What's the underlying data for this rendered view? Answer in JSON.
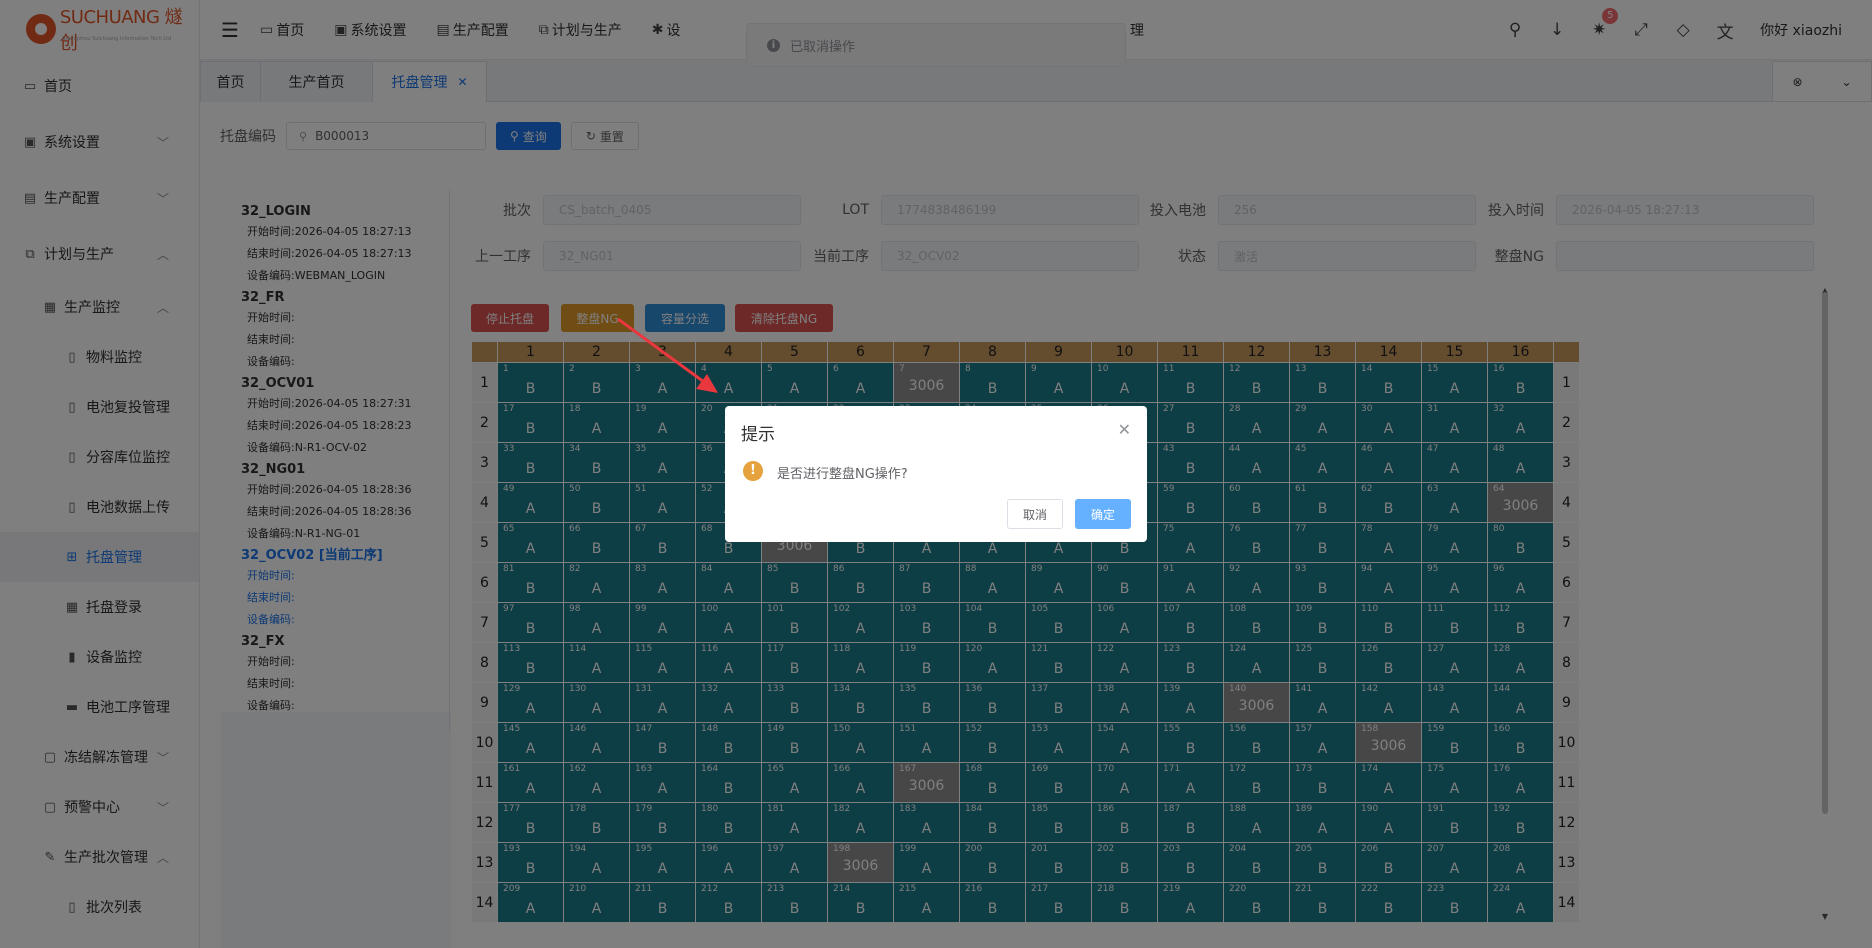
{
  "brand": {
    "logo_text": "SUCHUANG 燧创",
    "logo_sub": "Guangzhou Suichuang Information Tech Ltd"
  },
  "sidebar": {
    "items": [
      {
        "label": "首页",
        "icon": "monitor-icon",
        "level": 1
      },
      {
        "label": "系统设置",
        "icon": "user-badge-icon",
        "level": 1,
        "arrow": "down"
      },
      {
        "label": "生产配置",
        "icon": "briefcase-icon",
        "level": 1,
        "arrow": "down"
      },
      {
        "label": "计划与生产",
        "icon": "link-icon",
        "level": 1,
        "arrow": "up"
      },
      {
        "label": "生产监控",
        "icon": "device-icon",
        "level": 2,
        "arrow": "up"
      },
      {
        "label": "物料监控",
        "icon": "document-icon",
        "level": 3
      },
      {
        "label": "电池复投管理",
        "icon": "document-icon",
        "level": 3
      },
      {
        "label": "分容库位监控",
        "icon": "document-icon",
        "level": 3
      },
      {
        "label": "电池数据上传",
        "icon": "document-icon",
        "level": 3
      },
      {
        "label": "托盘管理",
        "icon": "basket-icon",
        "level": 3,
        "active": true
      },
      {
        "label": "托盘登录",
        "icon": "table-icon",
        "level": 3
      },
      {
        "label": "设备监控",
        "icon": "server-icon",
        "level": 3
      },
      {
        "label": "电池工序管理",
        "icon": "battery-icon",
        "level": 3
      },
      {
        "label": "冻结解冻管理",
        "icon": "folder-icon",
        "level": 2,
        "arrow": "down"
      },
      {
        "label": "预警中心",
        "icon": "folder-icon",
        "level": 2,
        "arrow": "down"
      },
      {
        "label": "生产批次管理",
        "icon": "edit-icon",
        "level": 2,
        "arrow": "up"
      },
      {
        "label": "批次列表",
        "icon": "document-icon",
        "level": 3
      }
    ]
  },
  "topnav": {
    "items": [
      {
        "label": "首页",
        "icon": "monitor-icon"
      },
      {
        "label": "系统设置",
        "icon": "user-badge-icon"
      },
      {
        "label": "生产配置",
        "icon": "briefcase-icon"
      },
      {
        "label": "计划与生产",
        "icon": "link-icon"
      },
      {
        "label": "设",
        "icon": "gear-icon"
      }
    ],
    "hidden_tail": "理",
    "greeting": "你好 xiaozhi",
    "notify_count": "5"
  },
  "toast": {
    "text": "已取消操作"
  },
  "tabs": {
    "items": [
      {
        "label": "首页"
      },
      {
        "label": "生产首页"
      },
      {
        "label": "托盘管理",
        "active": true
      }
    ]
  },
  "search": {
    "label": "托盘编码",
    "value": "B000013",
    "query": "查询",
    "reset": "重置"
  },
  "process": [
    {
      "name": "32_LOGIN",
      "lines": [
        "开始时间:2026-04-05 18:27:13",
        "结束时间:2026-04-05 18:27:13",
        "设备编码:WEBMAN_LOGIN"
      ]
    },
    {
      "name": "32_FR",
      "lines": [
        "开始时间:",
        "结束时间:",
        "设备编码:"
      ]
    },
    {
      "name": "32_OCV01",
      "lines": [
        "开始时间:2026-04-05 18:27:31",
        "结束时间:2026-04-05 18:28:23",
        "设备编码:N-R1-OCV-02"
      ]
    },
    {
      "name": "32_NG01",
      "lines": [
        "开始时间:2026-04-05 18:28:36",
        "结束时间:2026-04-05 18:28:36",
        "设备编码:N-R1-NG-01"
      ]
    },
    {
      "name": "32_OCV02 [当前工序]",
      "lines": [
        "开始时间:",
        "结束时间:",
        "设备编码:"
      ],
      "current": true
    },
    {
      "name": "32_FX",
      "lines": [
        "开始时间:",
        "结束时间:",
        "设备编码:"
      ]
    }
  ],
  "form": {
    "fields": [
      {
        "label": "批次",
        "value": "CS_batch_0405"
      },
      {
        "label": "LOT",
        "value": "1774838486199"
      },
      {
        "label": "投入电池",
        "value": "256"
      },
      {
        "label": "投入时间",
        "value": "2026-04-05 18:27:13"
      },
      {
        "label": "上一工序",
        "value": "32_NG01"
      },
      {
        "label": "当前工序",
        "value": "32_OCV02"
      },
      {
        "label": "状态",
        "value": "激活"
      },
      {
        "label": "整盘NG",
        "value": ""
      }
    ]
  },
  "actions": [
    {
      "label": "停止托盘",
      "color": "#d9534f"
    },
    {
      "label": "整盘NG",
      "color": "#e09a2b"
    },
    {
      "label": "容量分选",
      "color": "#2e8ed6"
    },
    {
      "label": "清除托盘NG",
      "color": "#d9534f"
    }
  ],
  "tray": {
    "columns": [
      "1",
      "2",
      "3",
      "4",
      "5",
      "6",
      "7",
      "8",
      "9",
      "10",
      "11",
      "12",
      "13",
      "14",
      "15",
      "16"
    ],
    "row_labels": [
      "1",
      "2",
      "3",
      "4",
      "5",
      "6",
      "7",
      "8",
      "9",
      "10",
      "11",
      "12",
      "13",
      "14"
    ],
    "ng_code": "3006",
    "rows": [
      "BBAAAANBAABBBBAB",
      "BAAAABBBBBBAAAAA",
      "BBAAABBABABAAAAA",
      "ABAAAABAAABBBBAN",
      "ABBBNBAAABABBAAB",
      "BAAABBBAABAABAAA",
      "BAAABABBBABBBBBB",
      "BAAABABABABABBAA",
      "AAAABBBBBAANAAAA",
      "AABBBAABAABBANBB",
      "AAABAANBBAABBAAA",
      "BBBBAAABBBBAAABB",
      "BAAAANABBBBBBBAA",
      "AABBBBABBBABBBBA"
    ]
  },
  "dialog": {
    "title": "提示",
    "message": "是否进行整盘NG操作?",
    "cancel": "取消",
    "confirm": "确定"
  }
}
